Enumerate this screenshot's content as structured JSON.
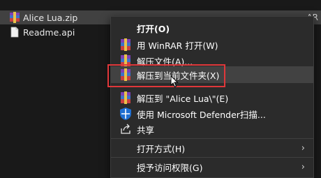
{
  "explorer": {
    "files": [
      {
        "name": "Alice Lua.zip",
        "icon": "winrar-archive-icon",
        "selected": true,
        "trailing": "AR"
      },
      {
        "name": "Readme.api",
        "icon": "file-icon",
        "selected": false,
        "trailing": ""
      }
    ]
  },
  "context_menu": {
    "items": [
      {
        "label": "打开(O)",
        "icon": "",
        "bold": true
      },
      {
        "label": "用 WinRAR 打开(W)",
        "icon": "winrar-icon"
      },
      {
        "label": "解压文件(A)...",
        "icon": "winrar-icon"
      },
      {
        "label": "解压到当前文件夹(X)",
        "icon": "winrar-icon",
        "highlighted": true
      },
      {
        "label": "解压到 \"Alice Lua\\\"(E)",
        "icon": "winrar-icon"
      },
      {
        "label": "使用 Microsoft Defender扫描...",
        "icon": "defender-shield-icon"
      },
      {
        "label": "共享",
        "icon": "share-icon"
      },
      {
        "label": "打开方式(H)",
        "icon": "",
        "submenu": true
      },
      {
        "label": "授予访问权限(G)",
        "icon": "",
        "submenu": true
      }
    ]
  },
  "colors": {
    "annotation": "#e0373a",
    "menu_bg": "#2b2b2b",
    "selection": "#414141"
  }
}
